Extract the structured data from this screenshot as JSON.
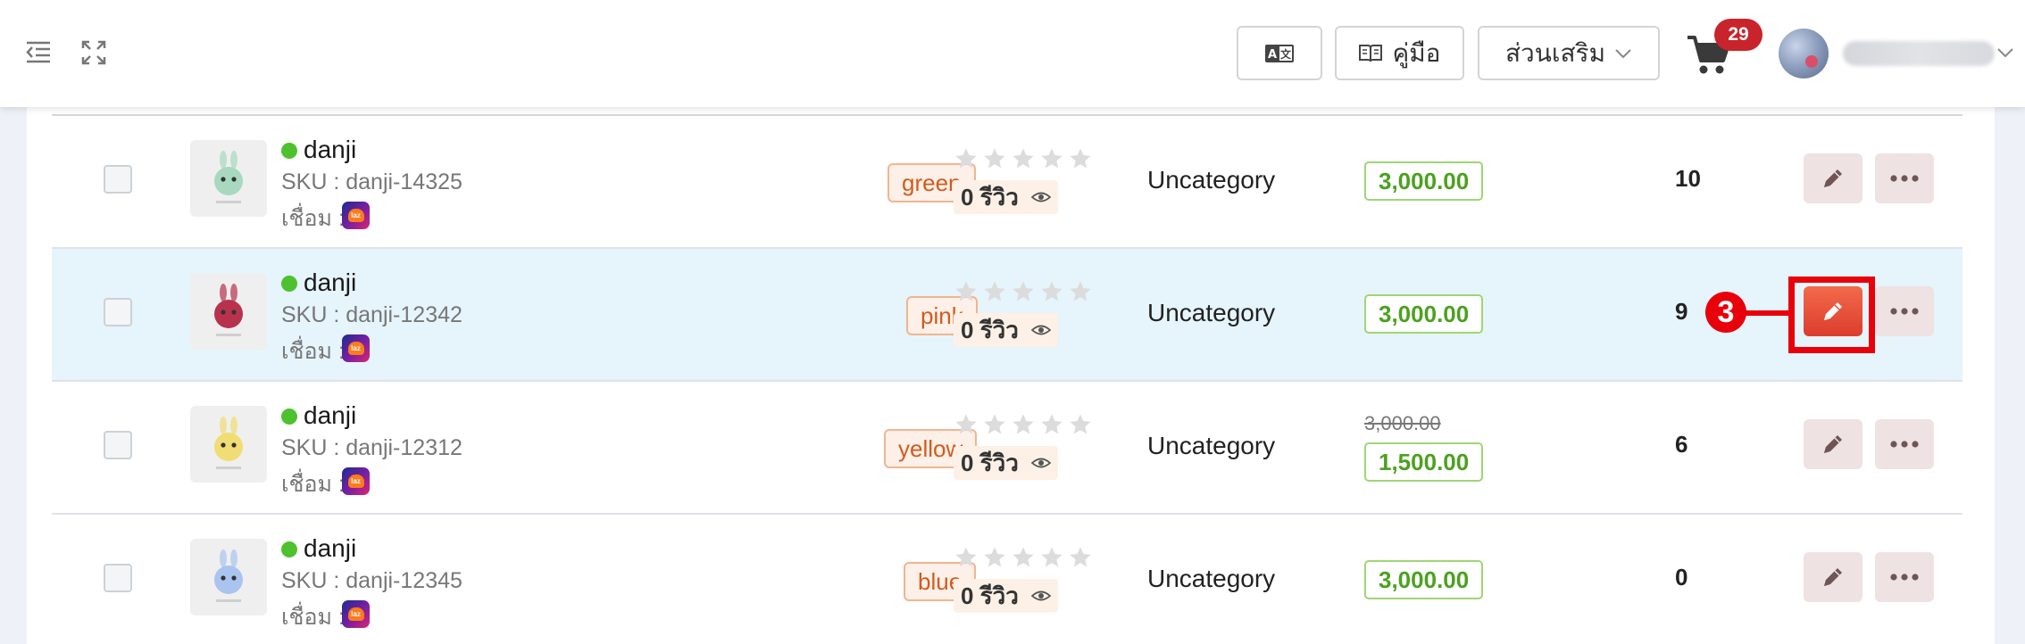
{
  "header": {
    "translate_icon": "translate-icon",
    "manual_label": "คู่มือ",
    "addon_label": "ส่วนเสริม",
    "cart_count": "29"
  },
  "link_label": "เชื่อม :",
  "review_suffix": "รีวิว",
  "rows": [
    {
      "name": "danji",
      "sku": "SKU : danji-14325",
      "variant": "green",
      "reviews": "0 รีวิว",
      "category": "Uncategory",
      "price": "3,000.00",
      "old_price": "",
      "stock": "10",
      "thumb_color": "#a8d8c0"
    },
    {
      "name": "danji",
      "sku": "SKU : danji-12342",
      "variant": "pink",
      "reviews": "0 รีวิว",
      "category": "Uncategory",
      "price": "3,000.00",
      "old_price": "",
      "stock": "9",
      "thumb_color": "#b8324d"
    },
    {
      "name": "danji",
      "sku": "SKU : danji-12312",
      "variant": "yellow",
      "reviews": "0 รีวิว",
      "category": "Uncategory",
      "price": "1,500.00",
      "old_price": "3,000.00",
      "stock": "6",
      "thumb_color": "#f0dd74"
    },
    {
      "name": "danji",
      "sku": "SKU : danji-12345",
      "variant": "blue",
      "reviews": "0 รีวิว",
      "category": "Uncategory",
      "price": "3,000.00",
      "old_price": "",
      "stock": "0",
      "thumb_color": "#a9c4ef"
    }
  ],
  "annotation": {
    "number": "3"
  },
  "colors": {
    "accent_red": "#e8000a",
    "price_green": "#4ca121",
    "variant_orange": "#d35a1c",
    "online_green": "#4dc22e"
  }
}
